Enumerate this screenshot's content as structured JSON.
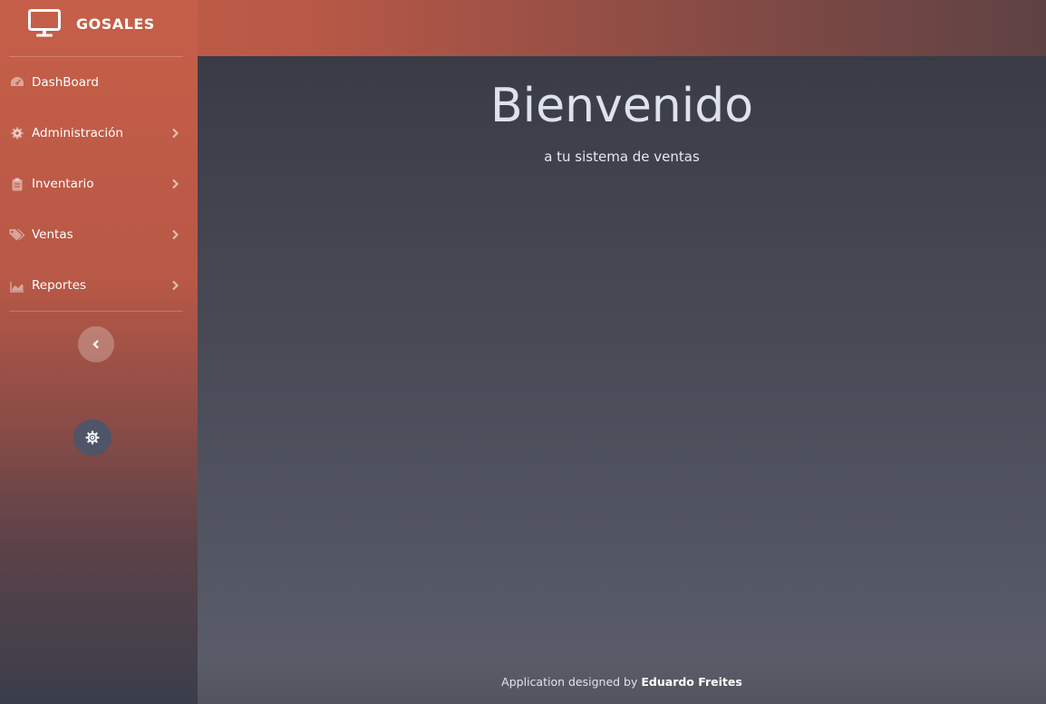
{
  "brand": {
    "name": "GOSALES",
    "icon": "monitor-icon"
  },
  "sidebar": {
    "items": [
      {
        "label": "DashBoard",
        "icon": "tachometer-icon",
        "has_submenu": false
      },
      {
        "label": "Administración",
        "icon": "cog-icon",
        "has_submenu": true
      },
      {
        "label": "Inventario",
        "icon": "clipboard-icon",
        "has_submenu": true
      },
      {
        "label": "Ventas",
        "icon": "tags-icon",
        "has_submenu": true
      },
      {
        "label": "Reportes",
        "icon": "area-chart-icon",
        "has_submenu": true
      }
    ],
    "toggle_icon": "chevron-left-icon",
    "settings_icon": "gear-icon"
  },
  "main": {
    "title": "Bienvenido",
    "subtitle": "a tu sistema de ventas"
  },
  "footer": {
    "prefix": "Application designed by",
    "author": "Eduardo Freites"
  },
  "colors": {
    "sidebar_top": "#c65f49",
    "sidebar_bottom": "#3a3e4c",
    "main_bg": "#474955",
    "settings_button": "#4f5468"
  }
}
